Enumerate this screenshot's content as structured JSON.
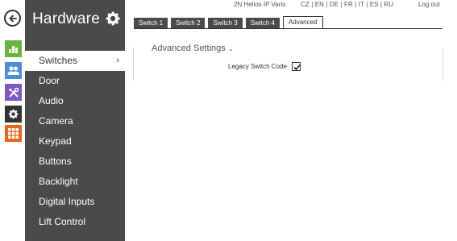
{
  "app": {
    "product": "2N Helios IP Vario",
    "logout": "Log out"
  },
  "languages": [
    "CZ",
    "EN",
    "DE",
    "FR",
    "IT",
    "ES",
    "RU"
  ],
  "rail": {
    "icons": [
      {
        "name": "back-icon"
      },
      {
        "name": "status-icon",
        "color": "#6bb33f"
      },
      {
        "name": "users-icon",
        "color": "#4a90d9"
      },
      {
        "name": "tools-icon",
        "color": "#7e57c2"
      },
      {
        "name": "settings-icon",
        "color": "#333333"
      },
      {
        "name": "apps-icon",
        "color": "#e8661e"
      }
    ]
  },
  "sidebar": {
    "title": "Hardware",
    "items": [
      {
        "label": "Switches",
        "active": true
      },
      {
        "label": "Door"
      },
      {
        "label": "Audio"
      },
      {
        "label": "Camera"
      },
      {
        "label": "Keypad"
      },
      {
        "label": "Buttons"
      },
      {
        "label": "Backlight"
      },
      {
        "label": "Digital Inputs"
      },
      {
        "label": "Lift Control"
      }
    ]
  },
  "tabs": [
    {
      "label": "Switch 1"
    },
    {
      "label": "Switch 2"
    },
    {
      "label": "Switch 3"
    },
    {
      "label": "Switch 4"
    },
    {
      "label": "Advanced",
      "active": true
    }
  ],
  "section": {
    "title": "Advanced Settings",
    "fields": [
      {
        "label": "Legacy Switch Code",
        "checked": true
      }
    ]
  }
}
